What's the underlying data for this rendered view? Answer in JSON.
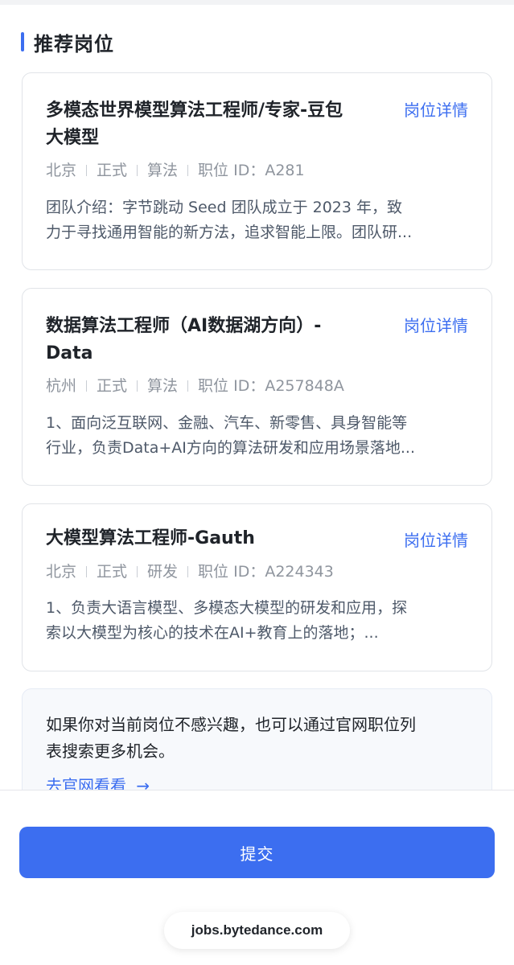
{
  "section": {
    "title": "推荐岗位"
  },
  "jobs": [
    {
      "title_line1": "多模态世界模型算法工程师/专家-豆包",
      "title_line2": "大模型",
      "link_label": "岗位详情",
      "city": "北京",
      "type": "正式",
      "category": "算法",
      "job_id": "职位 ID：A281",
      "desc_line1": "团队介绍：字节跳动 Seed 团队成立于 2023 年，致",
      "desc_line2": "力于寻找通用智能的新方法，追求智能上限。团队研..."
    },
    {
      "title_line1": "数据算法工程师（AI数据湖方向）-",
      "title_line2": "Data",
      "link_label": "岗位详情",
      "city": "杭州",
      "type": "正式",
      "category": "算法",
      "job_id": "职位 ID：A257848A",
      "desc_line1": "1、面向泛互联网、金融、汽车、新零售、具身智能等",
      "desc_line2": "行业，负责Data+AI方向的算法研发和应用场景落地..."
    },
    {
      "title_line1": "大模型算法工程师-Gauth",
      "link_label": "岗位详情",
      "city": "北京",
      "type": "正式",
      "category": "研发",
      "job_id": "职位 ID：A224343",
      "desc_line1": "1、负责大语言模型、多模态大模型的研发和应用，探",
      "desc_line2": "索以大模型为核心的技术在AI+教育上的落地；..."
    }
  ],
  "tip": {
    "text_line1": "如果你对当前岗位不感兴趣，也可以通过官网职位列",
    "text_line2": "表搜索更多机会。",
    "link_label": "去官网看看",
    "link_icon": "arrow-right-icon"
  },
  "footer": {
    "submit_label": "提交",
    "url": "jobs.bytedance.com"
  },
  "colors": {
    "accent": "#3c6ef0",
    "text_primary": "#1f2329",
    "text_secondary": "#8f959e"
  }
}
